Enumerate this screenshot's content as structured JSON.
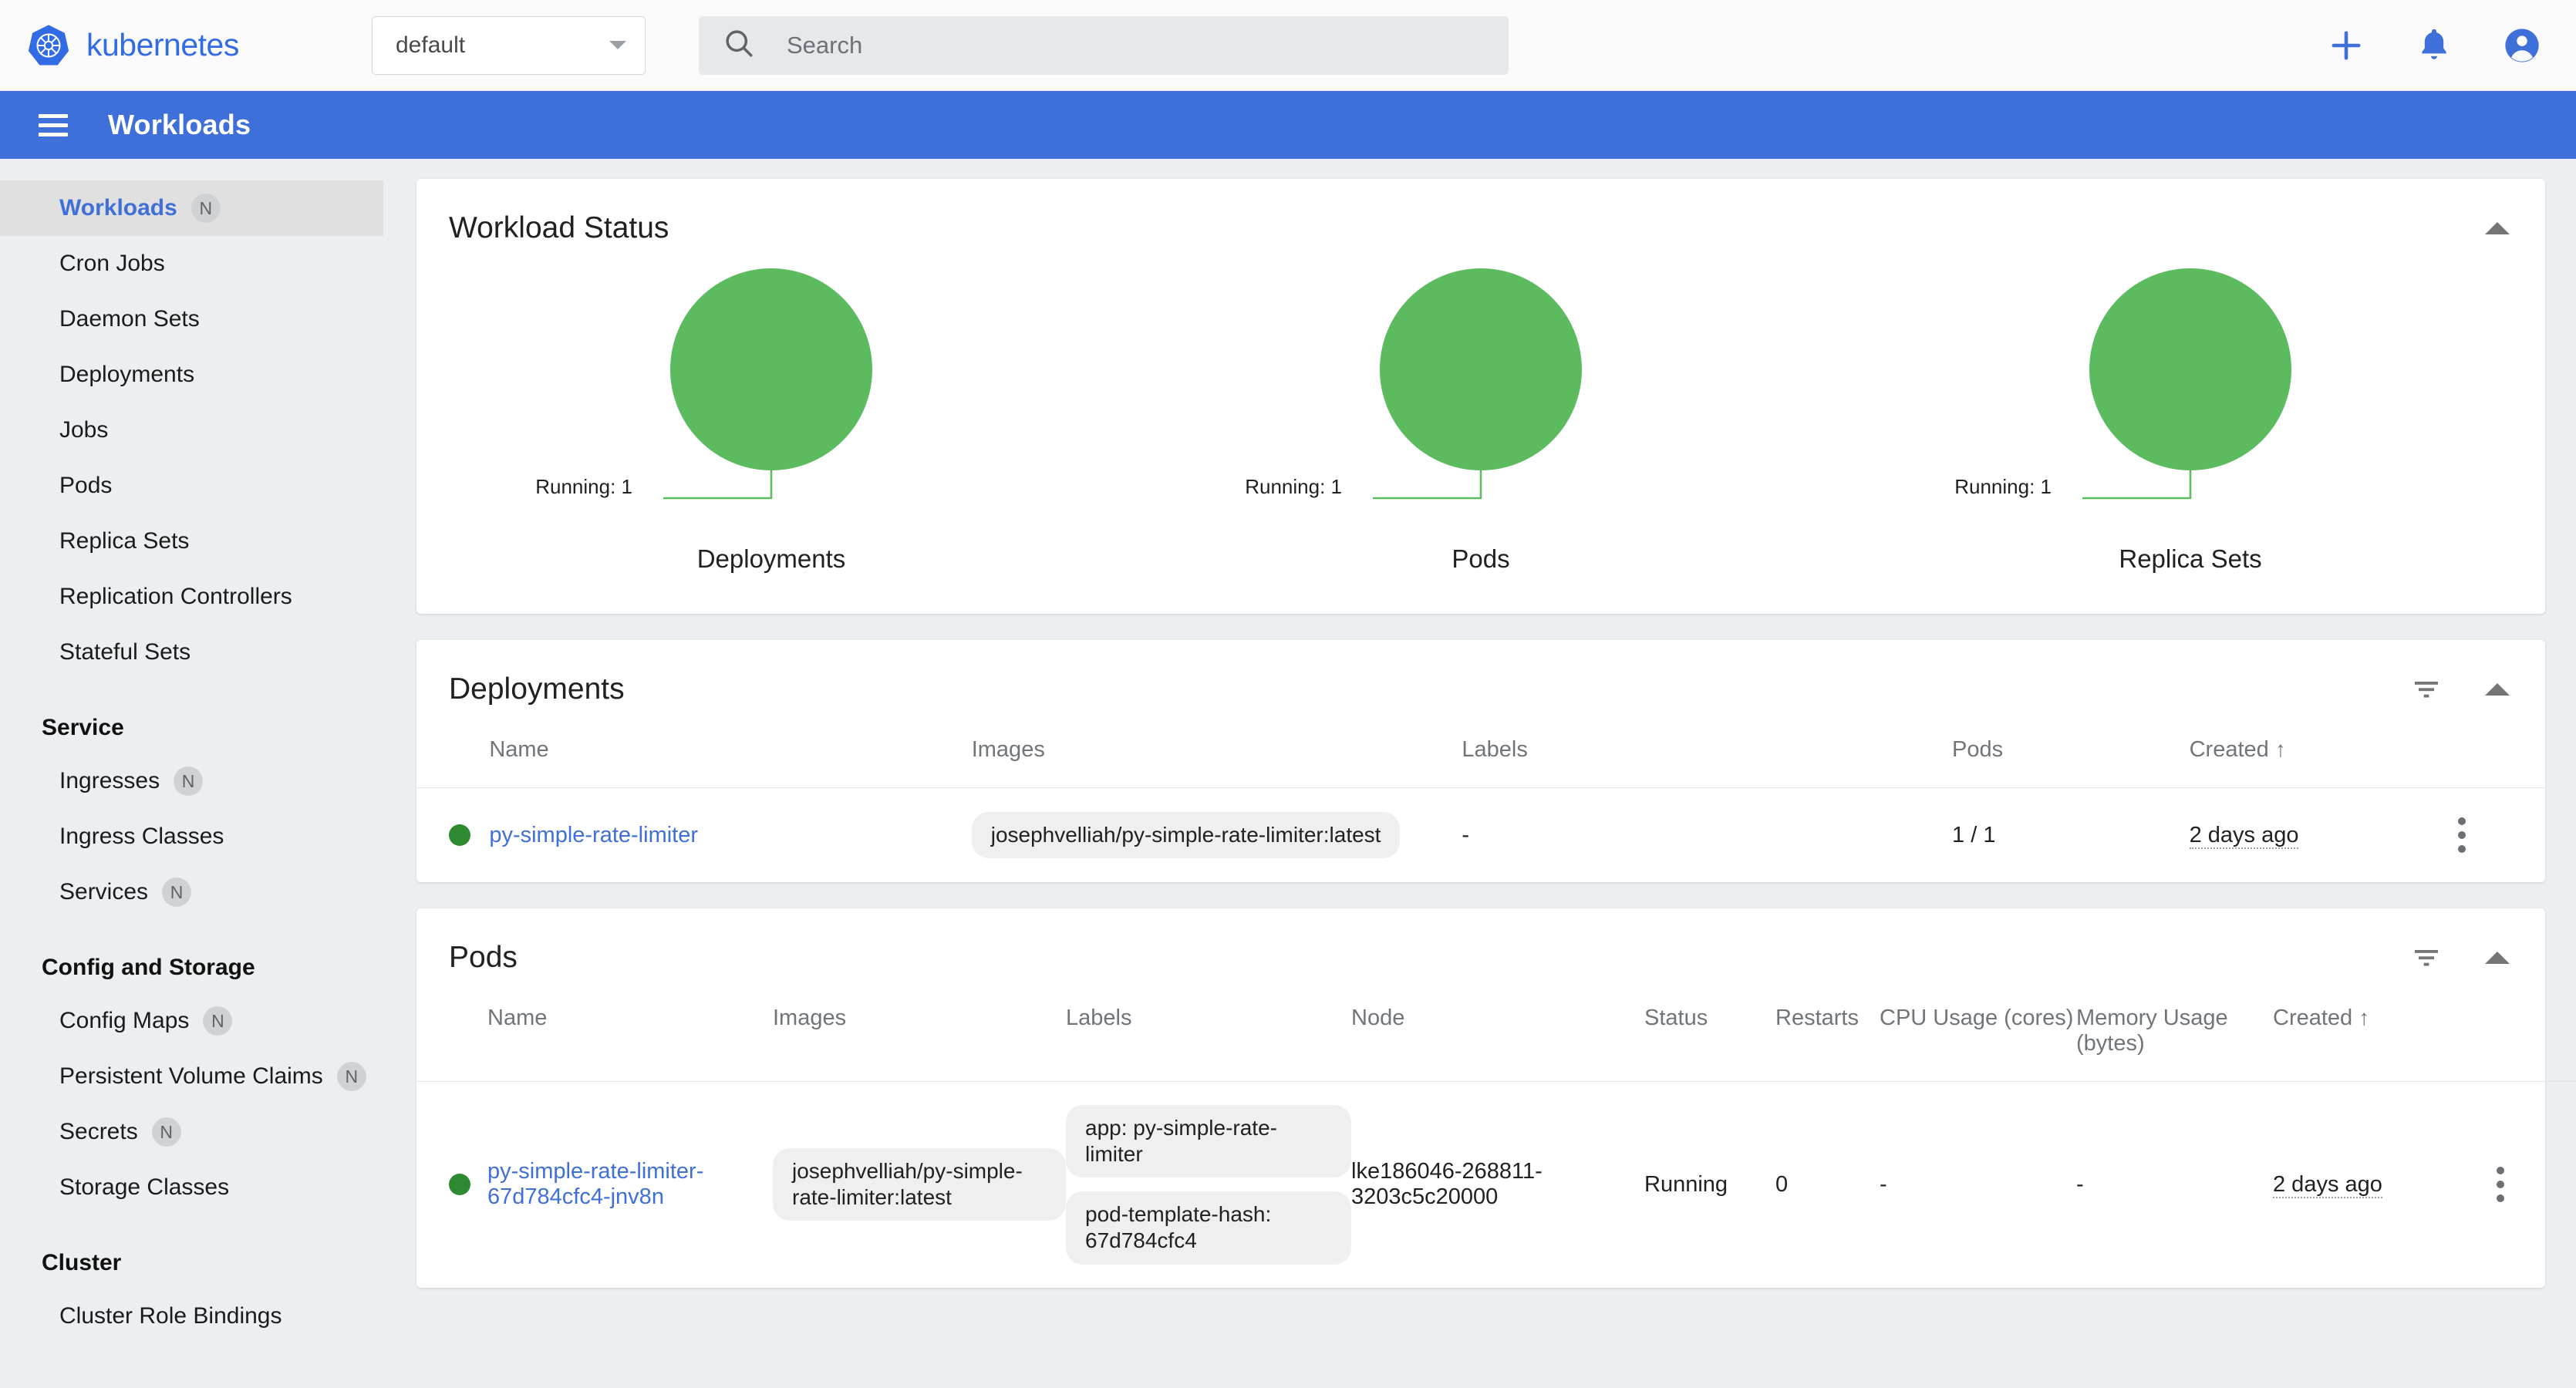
{
  "topbar": {
    "brand": "kubernetes",
    "namespace_value": "default",
    "search_placeholder": "Search",
    "search_value": ""
  },
  "appbar": {
    "title": "Workloads"
  },
  "sidebar": {
    "items": [
      {
        "label": "Workloads",
        "badge": "N",
        "active": true
      },
      {
        "label": "Cron Jobs",
        "badge": ""
      },
      {
        "label": "Daemon Sets",
        "badge": ""
      },
      {
        "label": "Deployments",
        "badge": ""
      },
      {
        "label": "Jobs",
        "badge": ""
      },
      {
        "label": "Pods",
        "badge": ""
      },
      {
        "label": "Replica Sets",
        "badge": ""
      },
      {
        "label": "Replication Controllers",
        "badge": ""
      },
      {
        "label": "Stateful Sets",
        "badge": ""
      }
    ],
    "section_service": "Service",
    "service_items": [
      {
        "label": "Ingresses",
        "badge": "N"
      },
      {
        "label": "Ingress Classes",
        "badge": ""
      },
      {
        "label": "Services",
        "badge": "N"
      }
    ],
    "section_config": "Config and Storage",
    "config_items": [
      {
        "label": "Config Maps",
        "badge": "N"
      },
      {
        "label": "Persistent Volume Claims",
        "badge": "N"
      },
      {
        "label": "Secrets",
        "badge": "N"
      },
      {
        "label": "Storage Classes",
        "badge": ""
      }
    ],
    "section_cluster": "Cluster",
    "cluster_items": [
      {
        "label": "Cluster Role Bindings",
        "badge": ""
      }
    ]
  },
  "workload_status": {
    "title": "Workload Status"
  },
  "chart_data": [
    {
      "type": "pie",
      "title": "Deployments",
      "categories": [
        "Running"
      ],
      "values": [
        1
      ],
      "labels": [
        "Running: 1"
      ],
      "colors": [
        "#5cba5f"
      ]
    },
    {
      "type": "pie",
      "title": "Pods",
      "categories": [
        "Running"
      ],
      "values": [
        1
      ],
      "labels": [
        "Running: 1"
      ],
      "colors": [
        "#5cba5f"
      ]
    },
    {
      "type": "pie",
      "title": "Replica Sets",
      "categories": [
        "Running"
      ],
      "values": [
        1
      ],
      "labels": [
        "Running: 1"
      ],
      "colors": [
        "#5cba5f"
      ]
    }
  ],
  "deployments": {
    "title": "Deployments",
    "columns": [
      "Name",
      "Images",
      "Labels",
      "Pods",
      "Created"
    ],
    "sort_column": "Created",
    "sort_arrow": "↑",
    "rows": [
      {
        "status": "healthy",
        "name": "py-simple-rate-limiter",
        "images": [
          "josephvelliah/py-simple-rate-limiter:latest"
        ],
        "labels": "-",
        "pods": "1 / 1",
        "created": "2 days ago"
      }
    ]
  },
  "pods": {
    "title": "Pods",
    "columns": [
      "Name",
      "Images",
      "Labels",
      "Node",
      "Status",
      "Restarts",
      "CPU Usage (cores)",
      "Memory Usage (bytes)",
      "Created"
    ],
    "sort_column": "Created",
    "sort_arrow": "↑",
    "rows": [
      {
        "status": "healthy",
        "name": "py-simple-rate-limiter-67d784cfc4-jnv8n",
        "images": [
          "josephvelliah/py-simple-rate-limiter:latest"
        ],
        "labels": [
          "app: py-simple-rate-limiter",
          "pod-template-hash: 67d784cfc4"
        ],
        "node": "lke186046-268811-3203c5c20000",
        "pod_status": "Running",
        "restarts": "0",
        "cpu": "-",
        "memory": "-",
        "created": "2 days ago"
      }
    ]
  },
  "colors": {
    "brand_blue": "#326ce5",
    "appbar_blue": "#3f6fd8",
    "status_green": "#5cba5f",
    "dot_green": "#2d8a30",
    "link_blue": "#3f6fd8"
  }
}
